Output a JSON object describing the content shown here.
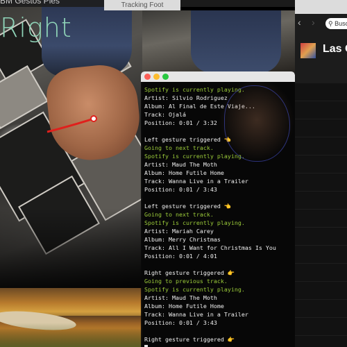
{
  "menubar": {
    "title": "BM Gestos Pies"
  },
  "camera_window": {
    "title": "Tracking Foot",
    "gesture_label": "Right"
  },
  "terminal": {
    "lines": [
      {
        "text": "Spotify is currently playing.",
        "color": "green"
      },
      {
        "text": "Artist: Silvio Rodriguez",
        "color": "white"
      },
      {
        "text": "Album: Al Final de Este Viaje...",
        "color": "white"
      },
      {
        "text": "Track: Ojalá",
        "color": "white"
      },
      {
        "text": "Position: 0:01 / 3:32",
        "color": "white"
      },
      {
        "text": "",
        "color": "blank"
      },
      {
        "text": "Left gesture triggered 👈",
        "color": "white"
      },
      {
        "text": "Going to next track.",
        "color": "green"
      },
      {
        "text": "Spotify is currently playing.",
        "color": "green"
      },
      {
        "text": "Artist: Maud The Moth",
        "color": "white"
      },
      {
        "text": "Album: Home Futile Home",
        "color": "white"
      },
      {
        "text": "Track: Wanna Live in a Trailer",
        "color": "white"
      },
      {
        "text": "Position: 0:01 / 3:43",
        "color": "white"
      },
      {
        "text": "",
        "color": "blank"
      },
      {
        "text": "Left gesture triggered 👈",
        "color": "white"
      },
      {
        "text": "Going to next track.",
        "color": "green"
      },
      {
        "text": "Spotify is currently playing.",
        "color": "green"
      },
      {
        "text": "Artist: Mariah Carey",
        "color": "white"
      },
      {
        "text": "Album: Merry Christmas",
        "color": "white"
      },
      {
        "text": "Track: All I Want for Christmas Is You",
        "color": "white"
      },
      {
        "text": "Position: 0:01 / 4:01",
        "color": "white"
      },
      {
        "text": "",
        "color": "blank"
      },
      {
        "text": "Right gesture triggered 👉",
        "color": "white"
      },
      {
        "text": "Going to previous track.",
        "color": "green"
      },
      {
        "text": "Spotify is currently playing.",
        "color": "green"
      },
      {
        "text": "Artist: Maud The Moth",
        "color": "white"
      },
      {
        "text": "Album: Home Futile Home",
        "color": "white"
      },
      {
        "text": "Track: Wanna Live in a Trailer",
        "color": "white"
      },
      {
        "text": "Position: 0:01 / 3:43",
        "color": "white"
      },
      {
        "text": "",
        "color": "blank"
      },
      {
        "text": "Right gesture triggered 👉",
        "color": "white"
      }
    ]
  },
  "spotify": {
    "search_placeholder": "Busca",
    "playlist_title": "Las C",
    "back_icon": "chevron-left-icon",
    "forward_icon": "chevron-right-icon"
  },
  "colors": {
    "terminal_green": "#9ccc3a",
    "terminal_white": "#f0f0f0",
    "gesture_label": "#8fd4b8",
    "tracking_line": "#e0201c"
  }
}
